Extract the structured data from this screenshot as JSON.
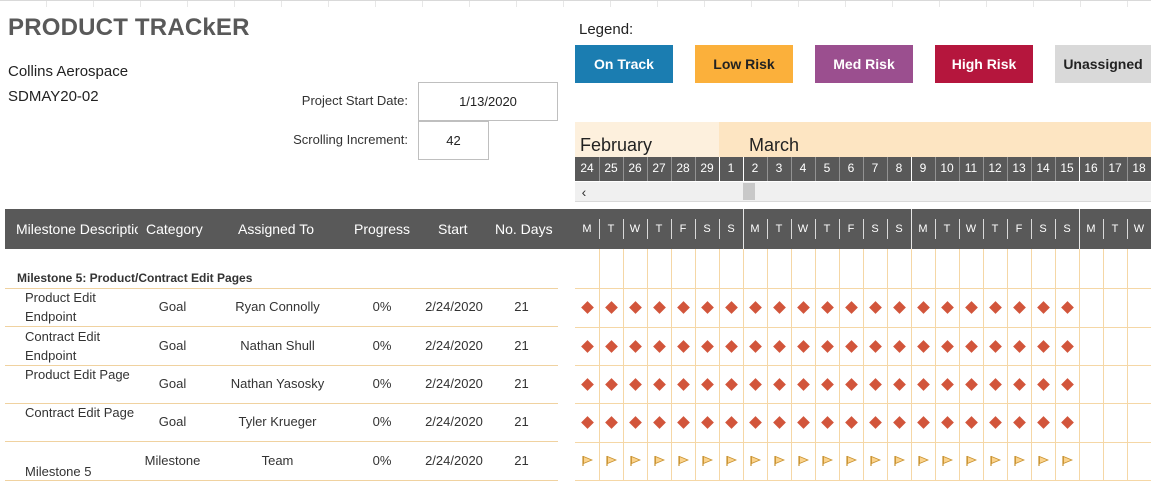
{
  "app": {
    "title": "PRODUCT TRACkER",
    "company": "Collins Aerospace",
    "project_code": "SDMAY20-02"
  },
  "settings": {
    "start_date_label": "Project Start Date:",
    "start_date_value": "1/13/2020",
    "increment_label": "Scrolling Increment:",
    "increment_value": "42"
  },
  "legend": {
    "title": "Legend:",
    "items": [
      {
        "label": "On Track",
        "color": "#1b7db1"
      },
      {
        "label": "Low Risk",
        "color": "#fbb03b"
      },
      {
        "label": "Med Risk",
        "color": "#9b4f8f"
      },
      {
        "label": "High Risk",
        "color": "#b5163d"
      },
      {
        "label": "Unassigned",
        "color": "#d9d9d9"
      }
    ]
  },
  "timeline": {
    "months": [
      "February",
      "March"
    ],
    "days": [
      "24",
      "25",
      "26",
      "27",
      "28",
      "29",
      "1",
      "2",
      "3",
      "4",
      "5",
      "6",
      "7",
      "8",
      "9",
      "10",
      "11",
      "12",
      "13",
      "14",
      "15",
      "16",
      "17",
      "18"
    ],
    "weekdays": [
      "M",
      "T",
      "W",
      "T",
      "F",
      "S",
      "S",
      "M",
      "T",
      "W",
      "T",
      "F",
      "S",
      "S",
      "M",
      "T",
      "W",
      "T",
      "F",
      "S",
      "S",
      "M",
      "T",
      "W"
    ],
    "scroll_left_glyph": "‹"
  },
  "columns": {
    "description": "Milestone Description",
    "category": "Category",
    "assigned": "Assigned To",
    "progress": "Progress",
    "start": "Start",
    "days": "No. Days"
  },
  "group": {
    "title": "Milestone 5: Product/Contract Edit Pages"
  },
  "tasks": [
    {
      "desc": "Product Edit Endpoint",
      "category": "Goal",
      "assigned": "Ryan Connolly",
      "progress": "0%",
      "start": "2/24/2020",
      "days": "21",
      "marker": "diamond"
    },
    {
      "desc": "Contract Edit Endpoint",
      "category": "Goal",
      "assigned": "Nathan Shull",
      "progress": "0%",
      "start": "2/24/2020",
      "days": "21",
      "marker": "diamond"
    },
    {
      "desc": "Product Edit Page",
      "category": "Goal",
      "assigned": "Nathan Yasosky",
      "progress": "0%",
      "start": "2/24/2020",
      "days": "21",
      "marker": "diamond"
    },
    {
      "desc": "Contract Edit Page",
      "category": "Goal",
      "assigned": "Tyler Krueger",
      "progress": "0%",
      "start": "2/24/2020",
      "days": "21",
      "marker": "diamond"
    },
    {
      "desc": "Milestone 5",
      "category": "Milestone",
      "assigned": "Team",
      "progress": "0%",
      "start": "2/24/2020",
      "days": "21",
      "marker": "flag"
    }
  ],
  "colors": {
    "diamond": "#d2553b",
    "flag_fill": "#fbd38d",
    "flag_stroke": "#c8912e"
  }
}
